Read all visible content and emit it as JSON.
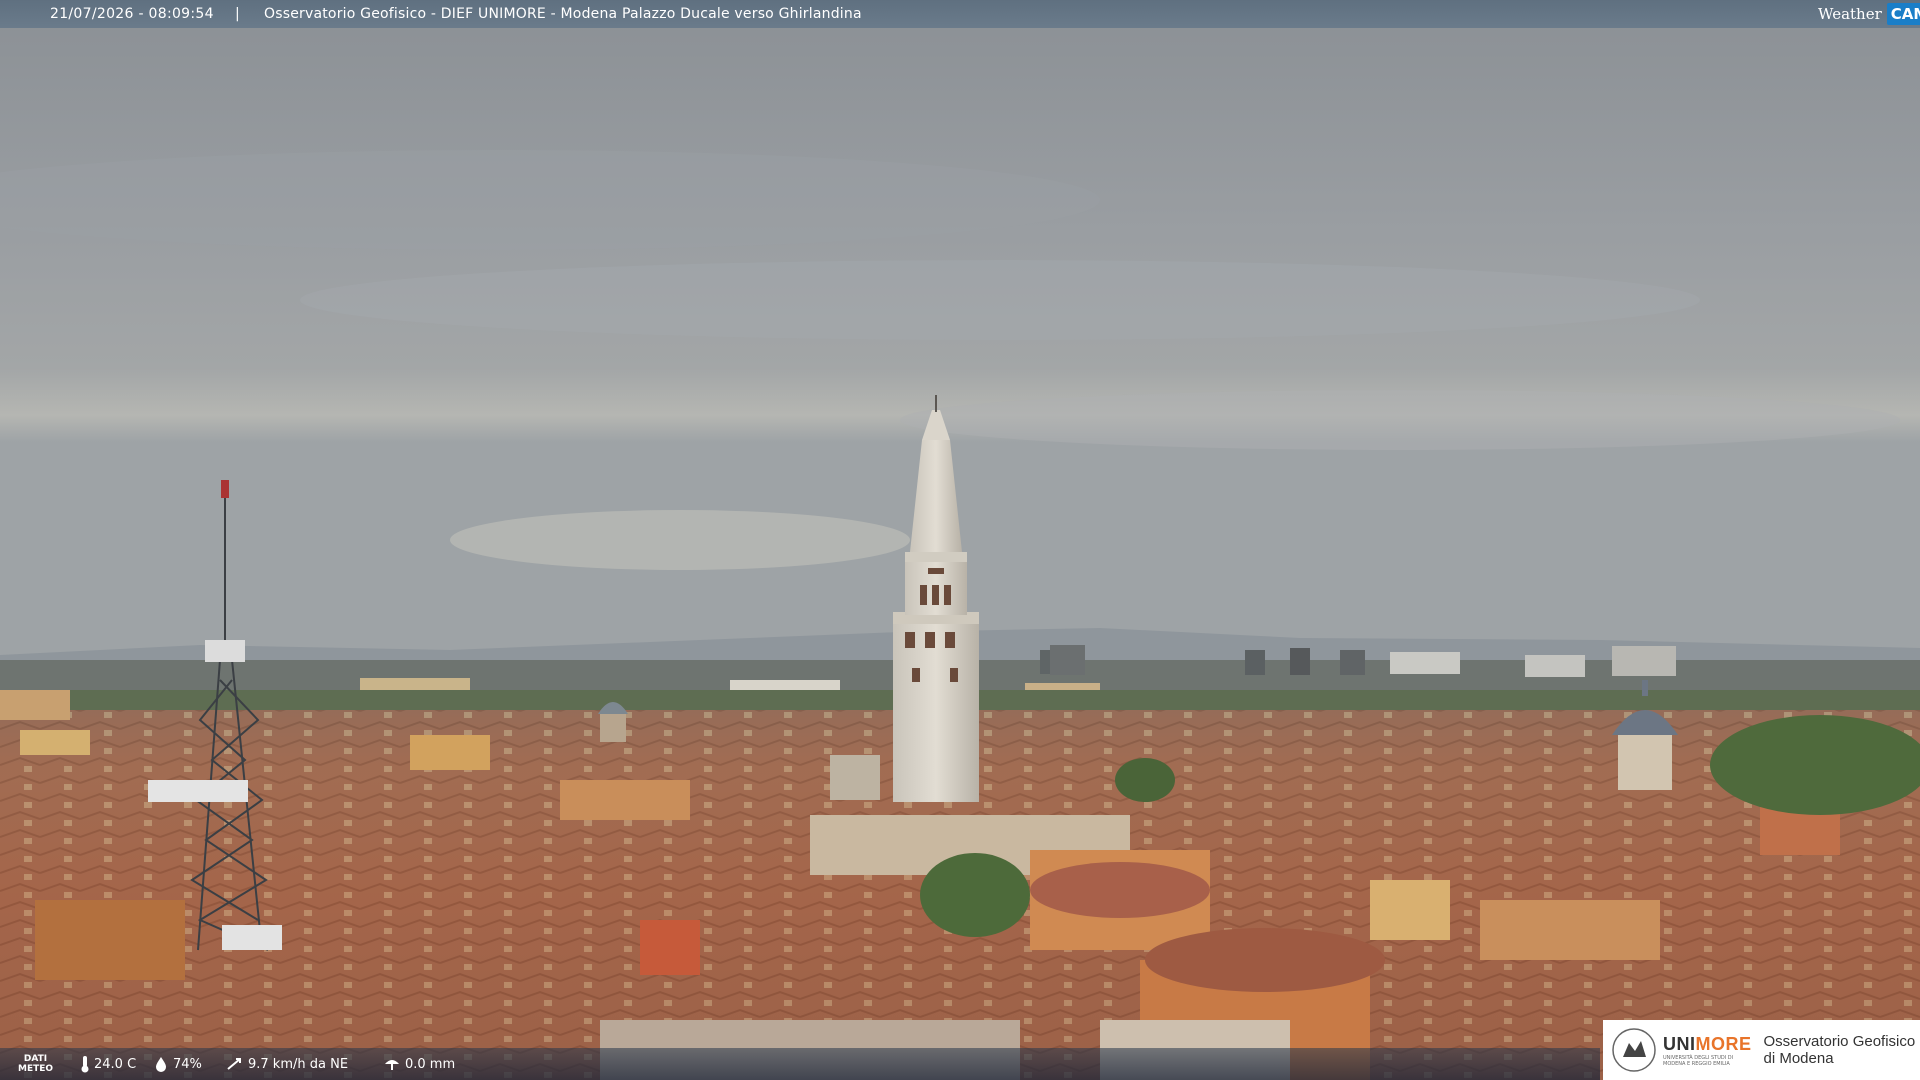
{
  "overlay": {
    "timestamp": "21/07/2026 - 08:09:54",
    "separator": "|",
    "title": "Osservatorio Geofisico - DIEF UNIMORE - Modena Palazzo Ducale verso Ghirlandina",
    "logo_weather": "Weather",
    "logo_cam": "CAM"
  },
  "weather": {
    "label_line1": "DATI",
    "label_line2": "METEO",
    "temperature": "24.0 C",
    "humidity": "74%",
    "wind": "9.7 km/h da NE",
    "rain": "0.0 mm",
    "icons": [
      "thermometer-icon",
      "humidity-icon",
      "wind-icon",
      "rain-icon"
    ]
  },
  "branding": {
    "uni_prefix": "UNI",
    "uni_suffix": "MORE",
    "uni_subtitle": "UNIVERSITÀ DEGLI STUDI DI MODENA E REGGIO EMILIA",
    "observatory_line1": "Osservatorio Geofisico",
    "observatory_line2": "di Modena"
  },
  "colors": {
    "topbar": "#65768a",
    "cam_accent": "#1a7ec8",
    "unimore_accent": "#e8742a",
    "roof": "#a8664a",
    "sky": "#9a9fa3"
  }
}
